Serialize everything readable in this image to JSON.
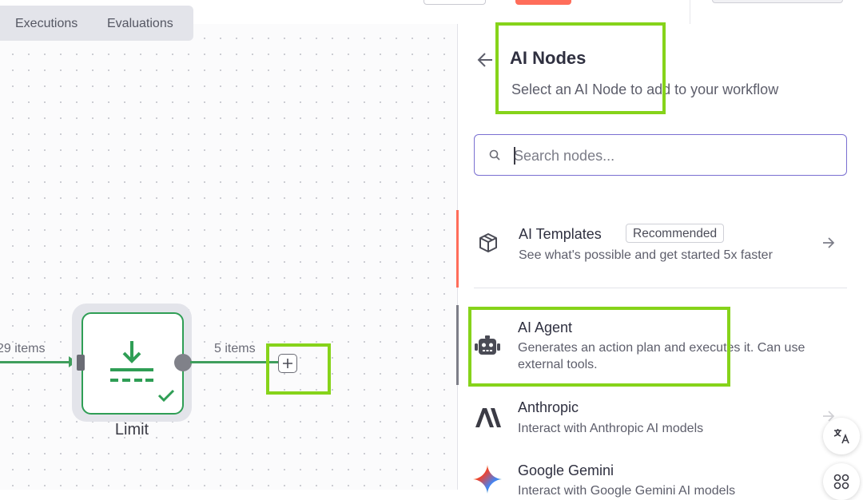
{
  "header": {
    "tabs": [
      {
        "label": "Executions"
      },
      {
        "label": "Evaluations"
      }
    ]
  },
  "canvas": {
    "edge_in_label": "29 items",
    "edge_out_label": "5 items",
    "node": {
      "label": "Limit",
      "icon": "limit-download-icon",
      "status": "success-check-icon",
      "color": "#2f9e55"
    }
  },
  "panel": {
    "title": "AI Nodes",
    "subtitle": "Select an AI Node to add to your workflow",
    "search": {
      "placeholder": "Search nodes...",
      "value": ""
    },
    "items": [
      {
        "title": "AI Templates",
        "badge": "Recommended",
        "description": "See what's possible and get started 5x faster",
        "icon": "box-icon"
      },
      {
        "title": "AI Agent",
        "description_line1": "Generates an action plan and executes it. Can use",
        "description_line2": "external tools.",
        "icon": "robot-icon"
      },
      {
        "title": "Anthropic",
        "description": "Interact with Anthropic AI models",
        "icon": "anthropic-logo-icon"
      },
      {
        "title": "Google Gemini",
        "description": "Interact with Google Gemini AI models",
        "icon": "gemini-logo-icon"
      }
    ]
  },
  "colors": {
    "accent": "#ff6d5a",
    "highlight": "#86d31a",
    "success": "#2f9e55",
    "focus": "#7a6fd1"
  }
}
